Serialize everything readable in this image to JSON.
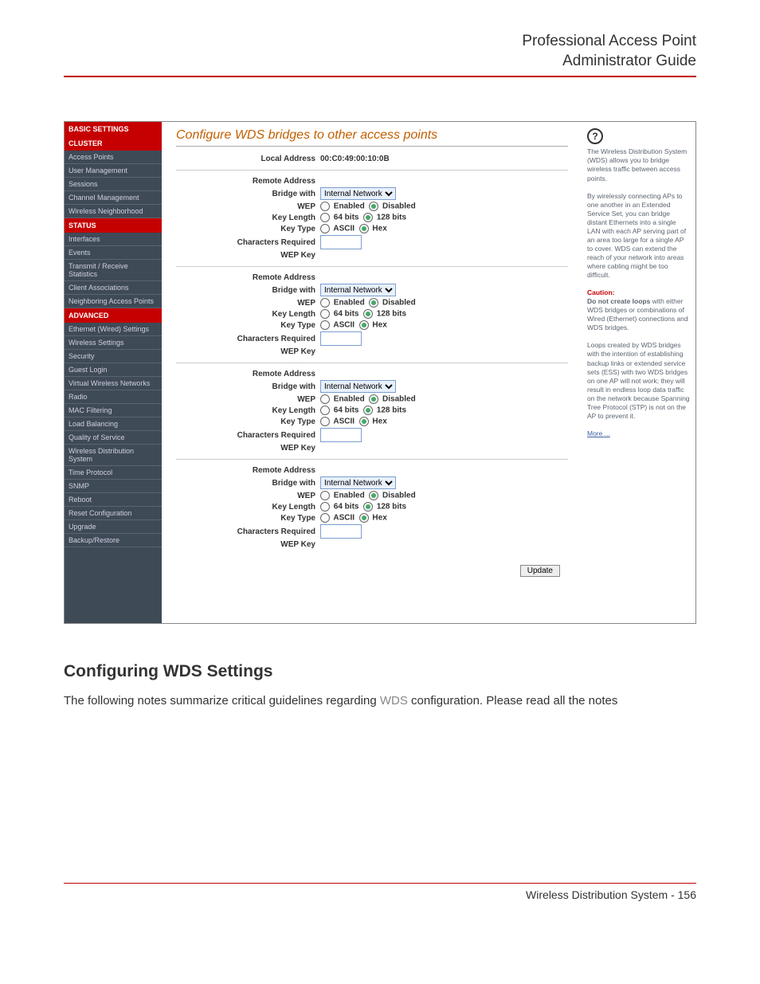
{
  "doc_header": {
    "line1": "Professional Access Point",
    "line2": "Administrator Guide"
  },
  "nav": {
    "basic_settings": "BASIC SETTINGS",
    "cluster": "CLUSTER",
    "cluster_items": [
      "Access Points",
      "User Management",
      "Sessions",
      "Channel Management",
      "Wireless Neighborhood"
    ],
    "status": "STATUS",
    "status_items": [
      "Interfaces",
      "Events",
      "Transmit / Receive Statistics",
      "Client Associations",
      "Neighboring Access Points"
    ],
    "advanced": "ADVANCED",
    "advanced_items": [
      "Ethernet (Wired) Settings",
      "Wireless Settings",
      "Security",
      "Guest Login",
      "Virtual Wireless Networks",
      "Radio",
      "MAC Filtering",
      "Load Balancing",
      "Quality of Service",
      "Wireless Distribution System",
      "Time Protocol",
      "SNMP",
      "Reboot",
      "Reset Configuration",
      "Upgrade",
      "Backup/Restore"
    ]
  },
  "page_title": "Configure WDS bridges to other access points",
  "labels": {
    "local_address": "Local Address",
    "remote_address": "Remote Address",
    "bridge_with": "Bridge with",
    "wep": "WEP",
    "key_length": "Key Length",
    "key_type": "Key Type",
    "chars_required": "Characters Required",
    "wep_key": "WEP Key",
    "enabled": "Enabled",
    "disabled": "Disabled",
    "k64": "64 bits",
    "k128": "128 bits",
    "ascii": "ASCII",
    "hex": "Hex",
    "update": "Update"
  },
  "local_address_value": "00:C0:49:00:10:0B",
  "bridge_option": "Internal Network",
  "blocks": 4,
  "help": {
    "p1": "The Wireless Distribution System (WDS) allows you to bridge wireless traffic between access points.",
    "p2": "By wirelessly connecting APs to one another in an Extended Service Set, you can bridge distant Ethernets into a single LAN with each AP serving part of an area too large for a single AP to cover. WDS can extend the reach of your network into areas where cabling might be too difficult.",
    "caution_label": "Caution:",
    "caution_bold": "Do not create loops",
    "caution_rest": " with either WDS bridges or combinations of Wired (Ethernet) connections and WDS bridges.",
    "p3": "Loops created by WDS bridges with the intention of establishing backup links or extended service sets (ESS) with two WDS bridges on one AP will not work; they will result in endless loop data traffic on the network because Spanning Tree Protocol (STP) is not on the AP to prevent it.",
    "more": "More ..."
  },
  "section_heading": "Configuring WDS Settings",
  "body_text_pre": "The following notes summarize critical guidelines regarding ",
  "body_text_wds": "WDS",
  "body_text_post": " configuration. Please read all the notes",
  "footer": "Wireless Distribution System - 156"
}
